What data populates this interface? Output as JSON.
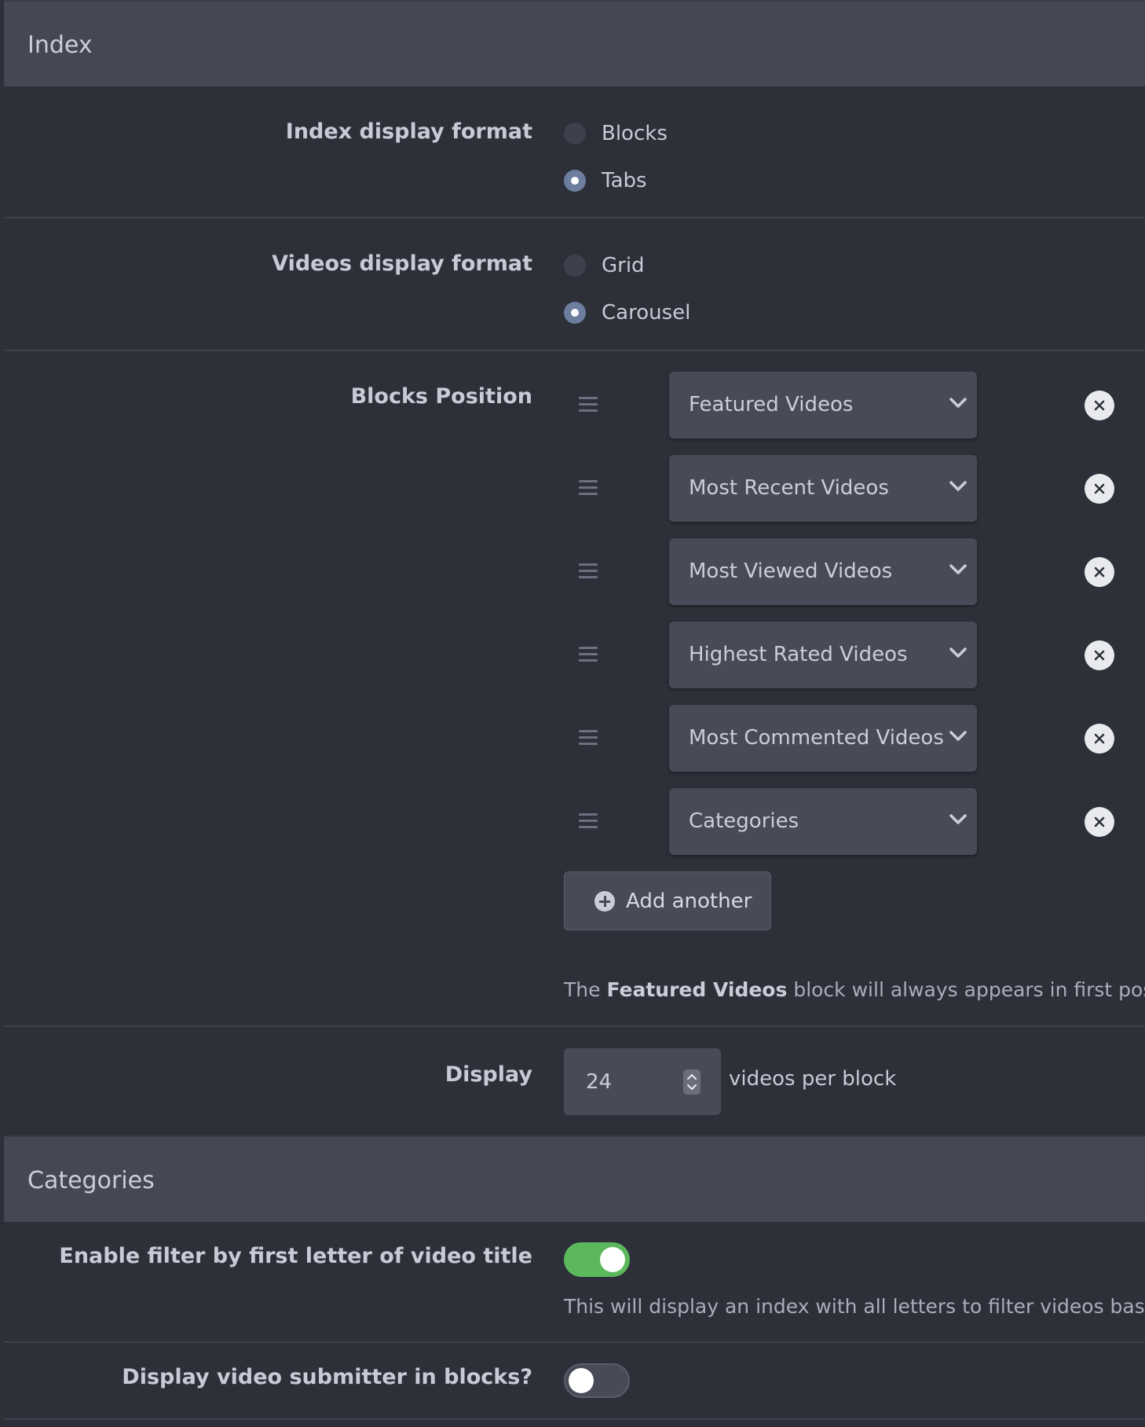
{
  "index_section": {
    "title": "Index",
    "index_display_format": {
      "label": "Index display format",
      "options": [
        "Blocks",
        "Tabs"
      ],
      "selected": "Tabs"
    },
    "videos_display_format": {
      "label": "Videos display format",
      "options": [
        "Grid",
        "Carousel"
      ],
      "selected": "Carousel"
    },
    "blocks_position": {
      "label": "Blocks Position",
      "blocks": [
        "Featured Videos",
        "Most Recent Videos",
        "Most Viewed Videos",
        "Highest Rated Videos",
        "Most Commented Videos",
        "Categories"
      ],
      "add_button": "Add another",
      "note_prefix": "The ",
      "note_bold": "Featured Videos",
      "note_suffix": " block will always appears in first positic"
    },
    "display": {
      "label": "Display",
      "value": "24",
      "suffix": "videos per block"
    }
  },
  "categories_section": {
    "title": "Categories",
    "filter_toggle": {
      "label": "Enable filter by first letter of video title",
      "enabled": true,
      "help": "This will display an index with all letters to filter videos based"
    },
    "submitter_toggle": {
      "label": "Display video submitter in blocks?",
      "enabled": false
    }
  },
  "colors": {
    "background": "#2d3039",
    "header": "#444855",
    "toggle_on": "#5cb85c",
    "radio_checked": "#6c7d9e"
  }
}
